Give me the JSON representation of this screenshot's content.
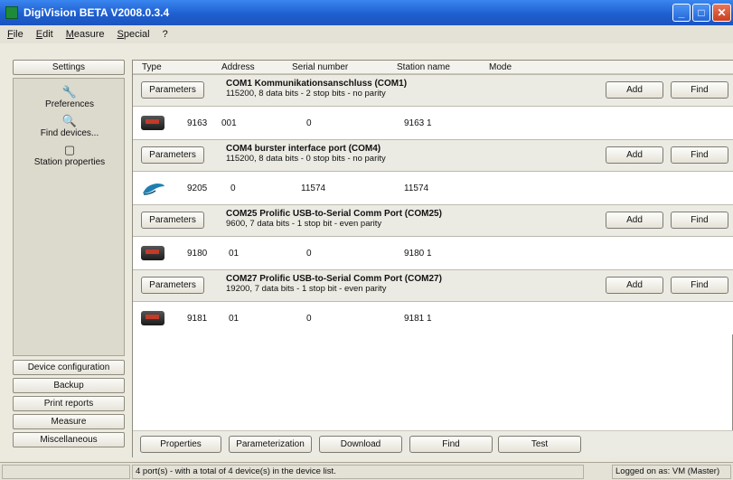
{
  "window": {
    "title": "DigiVision BETA V2008.0.3.4",
    "buttons": {
      "minimize": "_",
      "maximize": "□",
      "close": "✕"
    }
  },
  "menubar": {
    "items": [
      "File",
      "Edit",
      "Measure",
      "Special",
      "?"
    ]
  },
  "sidebar": {
    "settings_label": "Settings",
    "entries": [
      {
        "label": "Preferences",
        "icon": "wrench-icon",
        "glyph": "🔧"
      },
      {
        "label": "Find devices...",
        "icon": "magnifier-icon",
        "glyph": "🔍"
      },
      {
        "label": "Station properties",
        "icon": "station-icon",
        "glyph": "▢"
      }
    ],
    "bottom_buttons": [
      "Device configuration",
      "Backup",
      "Print reports",
      "Measure",
      "Miscellaneous"
    ]
  },
  "table": {
    "columns": [
      "Type",
      "Address",
      "Serial number",
      "Station name",
      "Mode"
    ],
    "ports": [
      {
        "title": "COM1 Kommunikationsanschluss (COM1)",
        "settings": "115200, 8 data bits - 2 stop bits - no parity",
        "parameters_label": "Parameters",
        "add_label": "Add",
        "find_label": "Find",
        "device": {
          "type": "9163",
          "address": "001",
          "serial": "0",
          "station": "9163 1",
          "icon": "device-icon"
        }
      },
      {
        "title": "COM4 burster interface port (COM4)",
        "settings": "115200, 8 data bits - 0 stop bits - no parity",
        "parameters_label": "Parameters",
        "add_label": "Add",
        "find_label": "Find",
        "device": {
          "type": "9205",
          "address": "0",
          "serial": "11574",
          "station": "11574",
          "icon": "mouse-icon"
        }
      },
      {
        "title": "COM25 Prolific USB-to-Serial Comm Port (COM25)",
        "settings": "9600, 7 data bits - 1 stop bit - even parity",
        "parameters_label": "Parameters",
        "add_label": "Add",
        "find_label": "Find",
        "device": {
          "type": "9180",
          "address": "01",
          "serial": "0",
          "station": "9180 1",
          "icon": "device-icon"
        }
      },
      {
        "title": "COM27 Prolific USB-to-Serial Comm Port (COM27)",
        "settings": "19200, 7 data bits - 1 stop bit - even parity",
        "parameters_label": "Parameters",
        "add_label": "Add",
        "find_label": "Find",
        "device": {
          "type": "9181",
          "address": "01",
          "serial": "0",
          "station": "9181 1",
          "icon": "device-icon"
        }
      }
    ]
  },
  "actions": [
    "Properties",
    "Parameterization",
    "Download",
    "Find",
    "Test"
  ],
  "statusbar": {
    "message": "4 port(s) - with a total of 4 device(s) in the device list.",
    "user": "Logged on as: VM (Master)"
  },
  "colors": {
    "titlebar": "#2a6fe0",
    "window_bg": "#ece9de",
    "device_accent": "#c23a2a"
  }
}
